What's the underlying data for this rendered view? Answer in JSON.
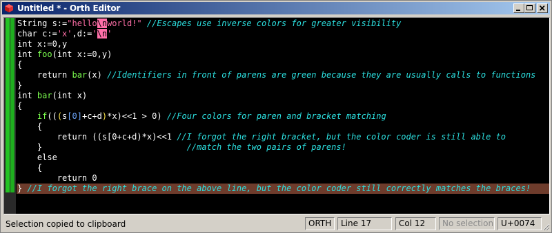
{
  "window": {
    "title": "Untitled * - Orth Editor",
    "icons": {
      "app": "app-cube-icon",
      "minimize": "minimize-icon",
      "maximize": "maximize-icon",
      "close": "close-icon"
    }
  },
  "colors": {
    "keyword": "#ffffff",
    "identifier_call": "#7cff4f",
    "string": "#ff6fa8",
    "comment": "#2ce0e0",
    "bracket_level2": "#ffe84d",
    "bracket_level3": "#6ea8ff",
    "current_line": "#6e3c2c",
    "gutter_marker": "#22c322"
  },
  "editor": {
    "lines": [
      [
        {
          "t": "String s:=",
          "c": "kw"
        },
        {
          "t": "\"hello",
          "c": "str"
        },
        {
          "t": "\\n",
          "c": "esc"
        },
        {
          "t": "world!\"",
          "c": "str"
        },
        {
          "t": " //Escapes use inverse colors for greater visibility",
          "c": "cm"
        }
      ],
      [
        {
          "t": "char c:=",
          "c": "kw"
        },
        {
          "t": "'x'",
          "c": "str"
        },
        {
          "t": ",d:=",
          "c": "kw"
        },
        {
          "t": "'",
          "c": "str"
        },
        {
          "t": "\\n",
          "c": "esc"
        },
        {
          "t": "'",
          "c": "str"
        }
      ],
      [
        {
          "t": "int x:=0,y",
          "c": "kw"
        }
      ],
      [
        {
          "t": "int ",
          "c": "kw"
        },
        {
          "t": "foo",
          "c": "green"
        },
        {
          "t": "(int x:=0,y)",
          "c": "kw"
        }
      ],
      [
        {
          "t": "{",
          "c": "kw"
        }
      ],
      [
        {
          "t": "    return ",
          "c": "kw"
        },
        {
          "t": "bar",
          "c": "green"
        },
        {
          "t": "(x) ",
          "c": "kw"
        },
        {
          "t": "//Identifiers in front of parens are green because they are usually calls to functions",
          "c": "cm"
        }
      ],
      [
        {
          "t": "}",
          "c": "kw"
        }
      ],
      [
        {
          "t": "int ",
          "c": "kw"
        },
        {
          "t": "bar",
          "c": "green"
        },
        {
          "t": "(int x)",
          "c": "kw"
        }
      ],
      [
        {
          "t": "{",
          "c": "kw"
        }
      ],
      [
        {
          "t": "    if",
          "c": "green"
        },
        {
          "t": "((",
          "c": "kw"
        },
        {
          "t": "(",
          "c": "brg"
        },
        {
          "t": "s",
          "c": "kw"
        },
        {
          "t": "[0]",
          "c": "brc"
        },
        {
          "t": "+c+d",
          "c": "kw"
        },
        {
          "t": ")",
          "c": "brg"
        },
        {
          "t": "*x)<<1 > 0) ",
          "c": "kw"
        },
        {
          "t": "//Four colors for paren and bracket matching",
          "c": "cm"
        }
      ],
      [
        {
          "t": "    {",
          "c": "kw"
        }
      ],
      [
        {
          "t": "        return ((s[0+c+d)*x)<<1 ",
          "c": "kw"
        },
        {
          "t": "//I forgot the right bracket, but the color coder is still able to",
          "c": "cm"
        }
      ],
      [
        {
          "t": "    }",
          "c": "kw"
        },
        {
          "t": "                             //match the two pairs of parens!",
          "c": "cm"
        }
      ],
      [
        {
          "t": "    else",
          "c": "kw"
        }
      ],
      [
        {
          "t": "    {",
          "c": "kw"
        }
      ],
      [
        {
          "t": "        return 0",
          "c": "kw"
        }
      ],
      [
        {
          "t": "} ",
          "c": "kw"
        },
        {
          "t": "//I forgot the right brace on the above line, but the color coder still correctly matches the braces!",
          "c": "cm"
        }
      ]
    ],
    "highlighted_line_index": 16
  },
  "status": {
    "message": "Selection copied to clipboard",
    "mode": "ORTH",
    "line": "Line 17",
    "col": "Col 12",
    "selection": "No selection",
    "codepoint": "U+0074"
  }
}
